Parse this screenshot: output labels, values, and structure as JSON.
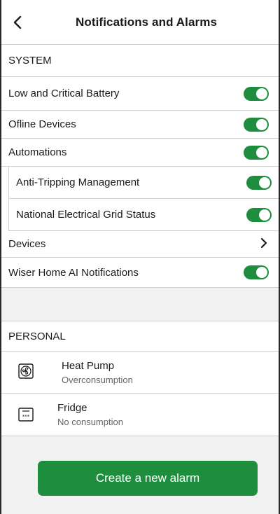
{
  "header": {
    "title": "Notifications and Alarms"
  },
  "system": {
    "heading": "SYSTEM",
    "items": [
      {
        "label": "Low and Critical Battery",
        "control": "toggle",
        "on": true
      },
      {
        "label": "Ofline Devices",
        "control": "toggle",
        "on": true
      },
      {
        "label": "Automations",
        "control": "toggle",
        "on": true
      },
      {
        "label": "Anti-Tripping Management",
        "control": "toggle",
        "on": true
      },
      {
        "label": "National Electrical Grid Status",
        "control": "toggle",
        "on": true
      },
      {
        "label": "Devices",
        "control": "chevron"
      },
      {
        "label": "Wiser Home AI Notifications",
        "control": "toggle",
        "on": true
      }
    ]
  },
  "personal": {
    "heading": "PERSONAL",
    "alarms": [
      {
        "title": "Heat Pump",
        "subtitle": "Overconsumption",
        "icon": "fan-icon"
      },
      {
        "title": "Fridge",
        "subtitle": "No consumption",
        "icon": "fridge-icon"
      }
    ]
  },
  "actions": {
    "create_label": "Create a new alarm"
  },
  "colors": {
    "accent": "#1e8e3e",
    "section_bg": "#f1f1f1",
    "divider": "#cfcfcf"
  }
}
